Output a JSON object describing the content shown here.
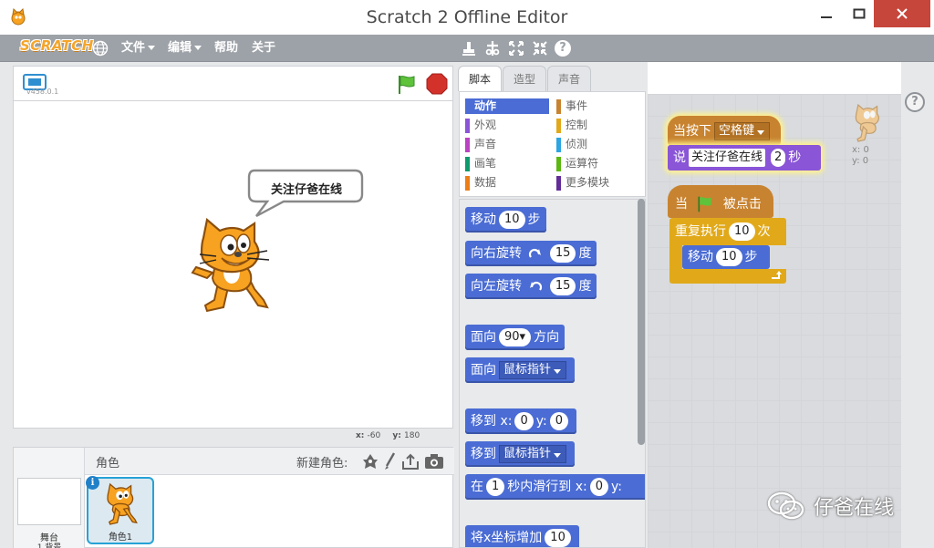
{
  "window": {
    "title": "Scratch 2 Offline Editor"
  },
  "menu": {
    "logo": "SCRATCH",
    "file": "文件",
    "edit": "编辑",
    "help": "帮助",
    "about": "关于"
  },
  "stage": {
    "version": "v458.0.1",
    "speech": "关注仔爸在线",
    "mouse_x_label": "x:",
    "mouse_x": "-60",
    "mouse_y_label": "y:",
    "mouse_y": "180"
  },
  "sprites": {
    "header_label": "角色",
    "new_sprite_label": "新建角色:",
    "stage_label": "舞台",
    "stage_backdrops": "1 背景",
    "sprite_name": "角色1",
    "info_glyph": "i"
  },
  "tabs": {
    "scripts": "脚本",
    "costumes": "造型",
    "sounds": "声音"
  },
  "categories": [
    {
      "label": "动作",
      "color": "#4a6cd4",
      "active": true
    },
    {
      "label": "事件",
      "color": "#c88330"
    },
    {
      "label": "外观",
      "color": "#8a55d7"
    },
    {
      "label": "控制",
      "color": "#e1a91a"
    },
    {
      "label": "声音",
      "color": "#bb42c3"
    },
    {
      "label": "侦测",
      "color": "#2ca5e2"
    },
    {
      "label": "画笔",
      "color": "#0e9a6c"
    },
    {
      "label": "运算符",
      "color": "#5cb712"
    },
    {
      "label": "数据",
      "color": "#ee7d16"
    },
    {
      "label": "更多模块",
      "color": "#632d99"
    }
  ],
  "palette": {
    "move": {
      "prefix": "移动",
      "value": "10",
      "suffix": "步"
    },
    "turn_right": {
      "prefix": "向右旋转",
      "value": "15",
      "suffix": "度"
    },
    "turn_left": {
      "prefix": "向左旋转",
      "value": "15",
      "suffix": "度"
    },
    "point_dir": {
      "prefix": "面向",
      "value": "90▾",
      "suffix": "方向"
    },
    "point_towards": {
      "prefix": "面向",
      "value": "鼠标指针"
    },
    "goto_xy": {
      "prefix": "移到 x:",
      "x": "0",
      "mid": "y:",
      "y": "0"
    },
    "goto": {
      "prefix": "移到",
      "value": "鼠标指针"
    },
    "glide": {
      "prefix": "在",
      "secs": "1",
      "mid": "秒内滑行到 x:",
      "x": "0",
      "suffix": "y:"
    },
    "change_x": {
      "prefix": "将x坐标增加",
      "value": "10"
    }
  },
  "scripts": {
    "key_hat": {
      "prefix": "当按下",
      "key": "空格键"
    },
    "say": {
      "prefix": "说",
      "message": "关注仔爸在线",
      "secs": "2",
      "suffix": "秒"
    },
    "flag_hat": {
      "prefix": "当",
      "suffix": "被点击"
    },
    "repeat": {
      "prefix": "重复执行",
      "count": "10",
      "suffix": "次"
    },
    "move": {
      "prefix": "移动",
      "value": "10",
      "suffix": "步"
    }
  },
  "sprite_info": {
    "x_label": "x:",
    "x": "0",
    "y_label": "y:",
    "y": "0"
  },
  "help_glyph": "?",
  "watermark": {
    "text": "仔爸在线"
  }
}
